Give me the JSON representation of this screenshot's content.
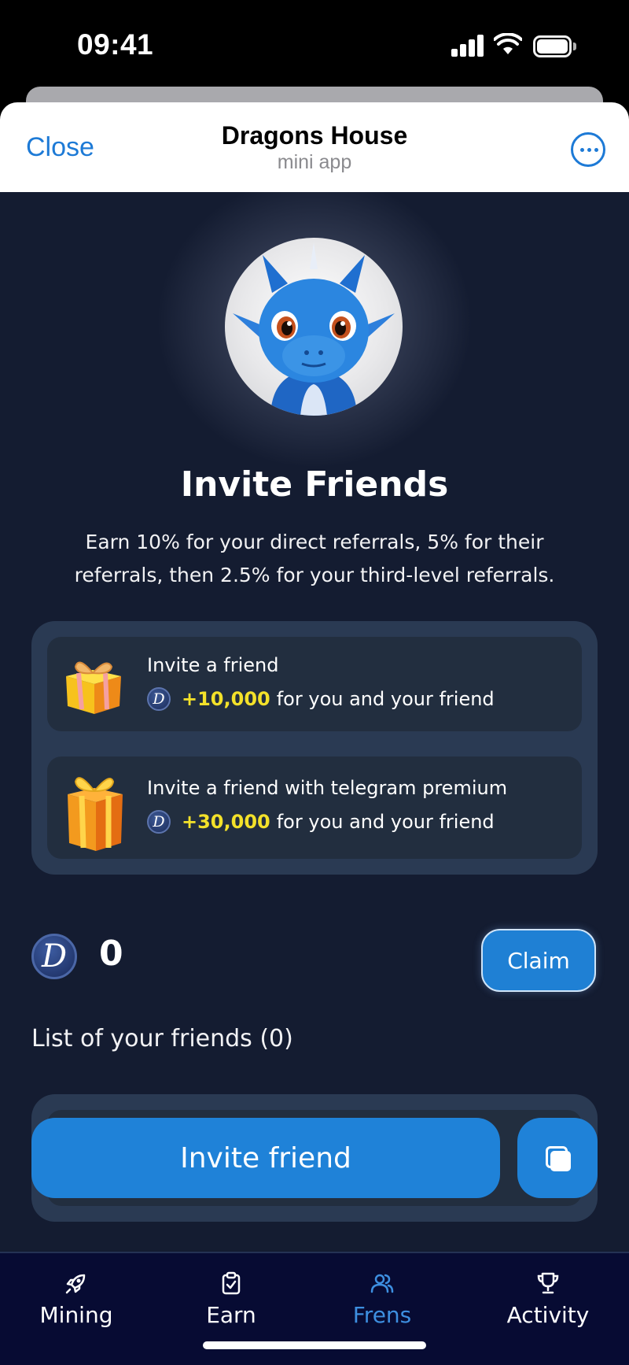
{
  "status_bar": {
    "time": "09:41"
  },
  "header": {
    "close_label": "Close",
    "title": "Dragons House",
    "subtitle": "mini app",
    "more_icon": "ellipsis-circle-icon"
  },
  "colors": {
    "accent": "#1f82d8",
    "background": "#141c31",
    "card": "#2a3a53",
    "highlight": "#f3e12a",
    "nav_bg": "#070b33"
  },
  "invite": {
    "heading": "Invite Friends",
    "description": "Earn 10% for your direct referrals, 5% for their referrals, then 2.5% for your third-level referrals.",
    "rewards": [
      {
        "title": "Invite a friend",
        "amount": "+10,000",
        "suffix": "for you and your friend",
        "coin": "D"
      },
      {
        "title": "Invite a friend with telegram premium",
        "amount": "+30,000",
        "suffix": "for you and your friend",
        "coin": "D"
      }
    ]
  },
  "balance": {
    "coin": "D",
    "value": "0",
    "claim_label": "Claim"
  },
  "friends": {
    "label": "List of your friends (0)",
    "invite_label": "Invite friend",
    "copy_icon": "copy-icon"
  },
  "nav": {
    "items": [
      {
        "label": "Mining",
        "icon": "rocket-icon",
        "active": false
      },
      {
        "label": "Earn",
        "icon": "clipboard-check-icon",
        "active": false
      },
      {
        "label": "Frens",
        "icon": "users-icon",
        "active": true
      },
      {
        "label": "Activity",
        "icon": "trophy-icon",
        "active": false
      }
    ]
  }
}
